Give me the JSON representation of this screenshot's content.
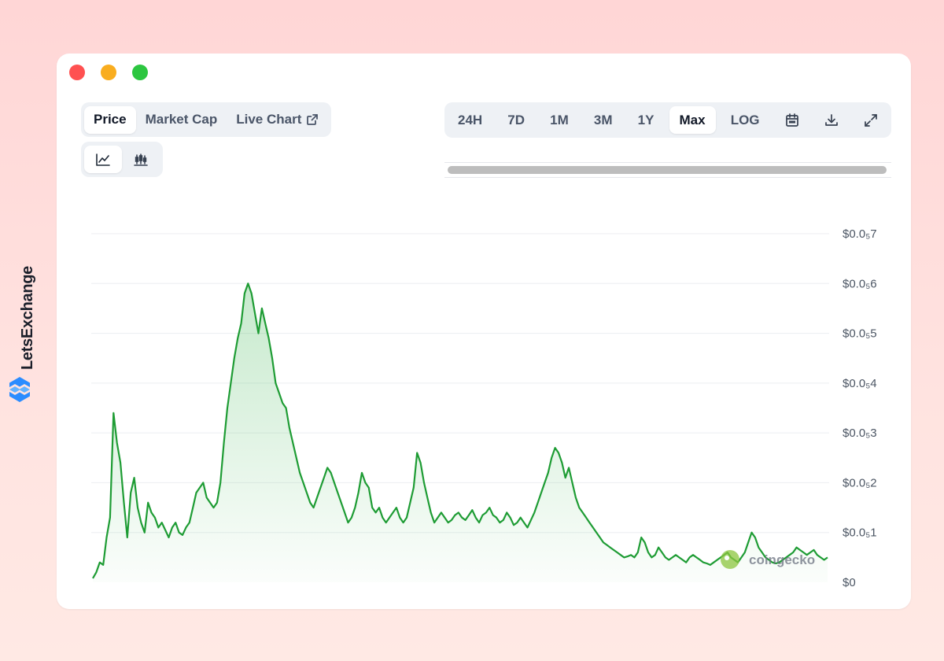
{
  "brand": {
    "name": "LetsExchange",
    "logo_icon": "letsexchange-logo-icon",
    "color": "#2b8cff"
  },
  "window": {
    "controls": [
      "close",
      "minimize",
      "maximize"
    ]
  },
  "tabs": [
    {
      "label": "Price",
      "active": true
    },
    {
      "label": "Market Cap",
      "active": false
    },
    {
      "label": "Live Chart",
      "active": false,
      "icon": "external-link-icon"
    }
  ],
  "chart_types": [
    {
      "icon": "line-chart-icon",
      "active": true
    },
    {
      "icon": "candlestick-icon",
      "active": false
    }
  ],
  "ranges": [
    {
      "label": "24H",
      "active": false
    },
    {
      "label": "7D",
      "active": false
    },
    {
      "label": "1M",
      "active": false
    },
    {
      "label": "3M",
      "active": false
    },
    {
      "label": "1Y",
      "active": false
    },
    {
      "label": "Max",
      "active": true
    },
    {
      "label": "LOG",
      "active": false
    }
  ],
  "range_icons": [
    "calendar-icon",
    "download-icon",
    "expand-icon"
  ],
  "watermark": "coingecko",
  "chart_data": {
    "type": "area",
    "line_color": "#1e9c34",
    "fill_color": "#34b24a",
    "grid": true,
    "legend": "none",
    "ylim": [
      0,
      7
    ],
    "yticks": [
      {
        "v": 0,
        "label": "$0"
      },
      {
        "v": 1,
        "label": "$0.0₅1"
      },
      {
        "v": 2,
        "label": "$0.0₅2"
      },
      {
        "v": 3,
        "label": "$0.0₅3"
      },
      {
        "v": 4,
        "label": "$0.0₅4"
      },
      {
        "v": 5,
        "label": "$0.0₅5"
      },
      {
        "v": 6,
        "label": "$0.0₅6"
      },
      {
        "v": 7,
        "label": "$0.0₅7"
      }
    ],
    "series": [
      {
        "values": [
          0.08,
          0.2,
          0.4,
          0.35,
          0.9,
          1.3,
          3.4,
          2.8,
          2.4,
          1.6,
          0.9,
          1.8,
          2.1,
          1.5,
          1.2,
          1.0,
          1.6,
          1.4,
          1.3,
          1.1,
          1.2,
          1.05,
          0.9,
          1.1,
          1.2,
          1.0,
          0.95,
          1.1,
          1.2,
          1.5,
          1.8,
          1.9,
          2.0,
          1.7,
          1.6,
          1.5,
          1.6,
          2.0,
          2.8,
          3.5,
          4.0,
          4.5,
          4.9,
          5.2,
          5.8,
          6.0,
          5.8,
          5.4,
          5.0,
          5.5,
          5.2,
          4.9,
          4.5,
          4.0,
          3.8,
          3.6,
          3.5,
          3.1,
          2.8,
          2.5,
          2.2,
          2.0,
          1.8,
          1.6,
          1.5,
          1.7,
          1.9,
          2.1,
          2.3,
          2.2,
          2.0,
          1.8,
          1.6,
          1.4,
          1.2,
          1.3,
          1.5,
          1.8,
          2.2,
          2.0,
          1.9,
          1.5,
          1.4,
          1.5,
          1.3,
          1.2,
          1.3,
          1.4,
          1.5,
          1.3,
          1.2,
          1.3,
          1.6,
          1.9,
          2.6,
          2.4,
          2.0,
          1.7,
          1.4,
          1.2,
          1.3,
          1.4,
          1.3,
          1.2,
          1.25,
          1.35,
          1.4,
          1.3,
          1.25,
          1.35,
          1.45,
          1.3,
          1.2,
          1.35,
          1.4,
          1.5,
          1.35,
          1.3,
          1.2,
          1.25,
          1.4,
          1.3,
          1.15,
          1.2,
          1.3,
          1.2,
          1.1,
          1.25,
          1.4,
          1.6,
          1.8,
          2.0,
          2.2,
          2.5,
          2.7,
          2.6,
          2.4,
          2.1,
          2.3,
          2.0,
          1.7,
          1.5,
          1.4,
          1.3,
          1.2,
          1.1,
          1.0,
          0.9,
          0.8,
          0.75,
          0.7,
          0.65,
          0.6,
          0.55,
          0.5,
          0.52,
          0.55,
          0.5,
          0.6,
          0.9,
          0.8,
          0.6,
          0.5,
          0.55,
          0.7,
          0.6,
          0.5,
          0.45,
          0.5,
          0.55,
          0.5,
          0.45,
          0.4,
          0.5,
          0.55,
          0.5,
          0.45,
          0.4,
          0.38,
          0.35,
          0.4,
          0.45,
          0.5,
          0.55,
          0.6,
          0.5,
          0.45,
          0.4,
          0.5,
          0.6,
          0.8,
          1.0,
          0.9,
          0.7,
          0.6,
          0.5,
          0.45,
          0.4,
          0.38,
          0.4,
          0.45,
          0.5,
          0.55,
          0.6,
          0.7,
          0.65,
          0.6,
          0.55,
          0.6,
          0.65,
          0.55,
          0.5,
          0.45,
          0.5
        ]
      }
    ]
  }
}
